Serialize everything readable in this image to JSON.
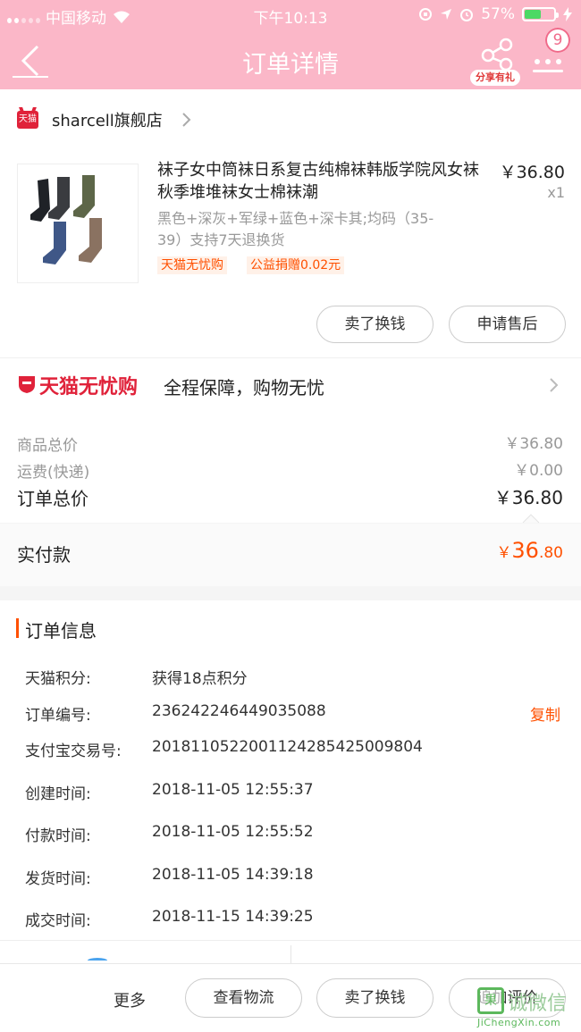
{
  "status_bar": {
    "carrier": "中国移动",
    "time": "下午10:13",
    "battery_percent": "57%",
    "battery_level": 0.57
  },
  "nav": {
    "title": "订单详情",
    "share_label": "分享有礼",
    "badge_count": "9"
  },
  "shop": {
    "logo_text": "天猫",
    "name": "sharcell旗舰店"
  },
  "product": {
    "title": "袜子女中筒袜日系复古纯棉袜韩版学院风女袜秋季堆堆袜女士棉袜潮",
    "price": "￥36.80",
    "quantity": "x1",
    "sku": "黑色+深灰+军绿+蓝色+深卡其;均码（35-39）支持7天退换货",
    "tags": [
      "天猫无忧购",
      "公益捐赠0.02元"
    ],
    "actions": [
      "卖了换钱",
      "申请售后"
    ]
  },
  "guarantee": {
    "brand": "天猫无忧购",
    "text": "全程保障，购物无忧"
  },
  "pricing": {
    "items": [
      {
        "label": "商品总价",
        "value": "￥36.80"
      },
      {
        "label": "运费(快递)",
        "value": "￥0.00"
      }
    ],
    "total_label": "订单总价",
    "total_value": "￥36.80",
    "paid_label": "实付款",
    "paid_symbol": "￥",
    "paid_int": "36",
    "paid_dec": ".80"
  },
  "order_info": {
    "title": "订单信息",
    "copy_label": "复制",
    "rows": [
      {
        "label": "天猫积分:",
        "value": "获得18点积分"
      },
      {
        "label": "订单编号:",
        "value": "236242246449035088"
      },
      {
        "label": "支付宝交易号:",
        "value": "2018110522001124285425009804"
      },
      {
        "label": "创建时间:",
        "value": "2018-11-05 12:55:37"
      },
      {
        "label": "付款时间:",
        "value": "2018-11-05 12:55:52"
      },
      {
        "label": "发货时间:",
        "value": "2018-11-05 14:39:18"
      },
      {
        "label": "成交时间:",
        "value": "2018-11-15 14:39:25"
      }
    ]
  },
  "bottom_bar": {
    "more_label": "更多",
    "buttons": [
      "查看物流",
      "卖了换钱",
      "追加评价"
    ]
  },
  "watermark": {
    "box_text": "果",
    "text": "诚微信",
    "domain": "JiChengXin.com"
  },
  "colors": {
    "header_pink": "#fbb7c8",
    "accent_orange": "#ff5000",
    "tmall_red": "#e0223a"
  }
}
